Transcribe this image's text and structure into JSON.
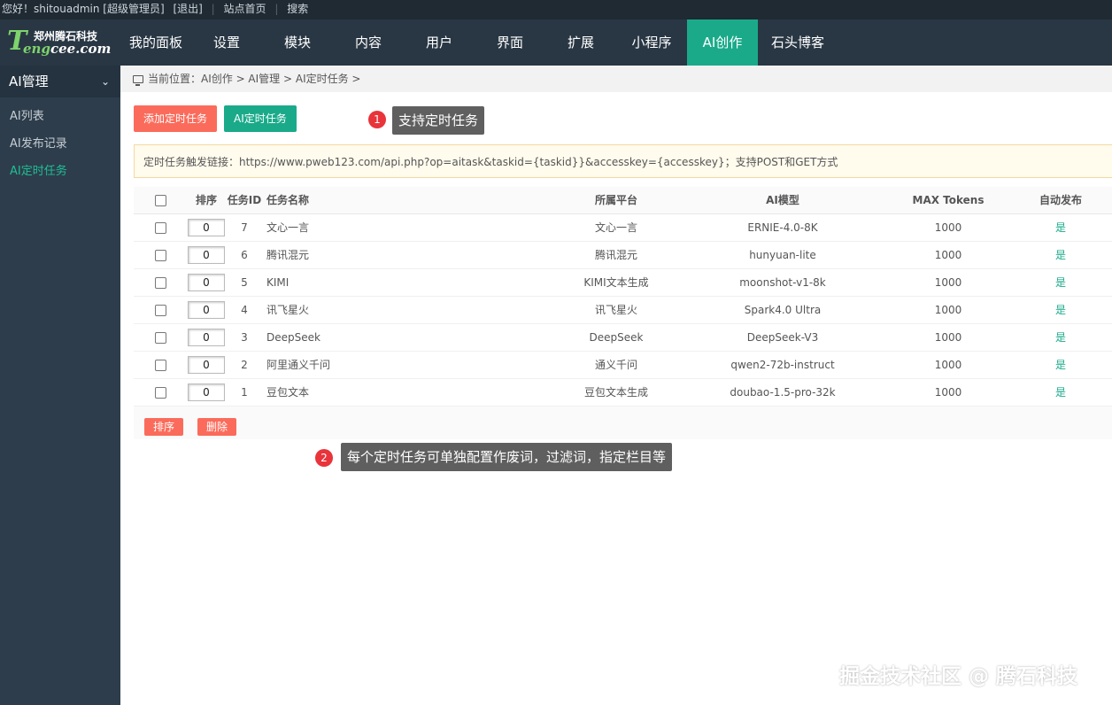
{
  "topbar": {
    "greeting": "您好！shitouadmin [超级管理员]",
    "logout": "[退出]",
    "site_home": "站点首页",
    "search": "搜索"
  },
  "logo": {
    "cn_name": "郑州腾石科技",
    "letter": "T",
    "en_hl": "eng",
    "en_rest": "cee.com"
  },
  "nav": [
    {
      "label": "我的面板",
      "active": false
    },
    {
      "label": "设置",
      "active": false
    },
    {
      "label": "模块",
      "active": false
    },
    {
      "label": "内容",
      "active": false
    },
    {
      "label": "用户",
      "active": false
    },
    {
      "label": "界面",
      "active": false
    },
    {
      "label": "扩展",
      "active": false
    },
    {
      "label": "小程序",
      "active": false
    },
    {
      "label": "AI创作",
      "active": true
    },
    {
      "label": "石头博客",
      "active": false
    }
  ],
  "sidebar": {
    "title": "AI管理",
    "items": [
      {
        "label": "AI列表",
        "active": false
      },
      {
        "label": "AI发布记录",
        "active": false
      },
      {
        "label": "AI定时任务",
        "active": true
      }
    ]
  },
  "breadcrumb": "当前位置：AI创作 > AI管理 > AI定时任务 >",
  "buttons": {
    "add_task": "添加定时任务",
    "ai_task": "AI定时任务",
    "sort": "排序",
    "delete": "删除"
  },
  "callouts": [
    {
      "num": "1",
      "text": "支持定时任务"
    },
    {
      "num": "2",
      "text": "每个定时任务可单独配置作废词，过滤词，指定栏目等"
    }
  ],
  "notice": "定时任务触发链接：https://www.pweb123.com/api.php?op=aitask&taskid={taskid}}&accesskey={accesskey}；支持POST和GET方式",
  "table": {
    "headers": {
      "sort": "排序",
      "task_id": "任务ID",
      "task_name": "任务名称",
      "platform": "所属平台",
      "model": "AI模型",
      "max_tokens": "MAX Tokens",
      "auto_publish": "自动发布"
    },
    "rows": [
      {
        "order": "0",
        "id": "7",
        "name": "文心一言",
        "platform": "文心一言",
        "model": "ERNIE-4.0-8K",
        "tokens": "1000",
        "auto": "是"
      },
      {
        "order": "0",
        "id": "6",
        "name": "腾讯混元",
        "platform": "腾讯混元",
        "model": "hunyuan-lite",
        "tokens": "1000",
        "auto": "是"
      },
      {
        "order": "0",
        "id": "5",
        "name": "KIMI",
        "platform": "KIMI文本生成",
        "model": "moonshot-v1-8k",
        "tokens": "1000",
        "auto": "是"
      },
      {
        "order": "0",
        "id": "4",
        "name": "讯飞星火",
        "platform": "讯飞星火",
        "model": "Spark4.0 Ultra",
        "tokens": "1000",
        "auto": "是"
      },
      {
        "order": "0",
        "id": "3",
        "name": "DeepSeek",
        "platform": "DeepSeek",
        "model": "DeepSeek-V3",
        "tokens": "1000",
        "auto": "是"
      },
      {
        "order": "0",
        "id": "2",
        "name": "阿里通义千问",
        "platform": "通义千问",
        "model": "qwen2-72b-instruct",
        "tokens": "1000",
        "auto": "是"
      },
      {
        "order": "0",
        "id": "1",
        "name": "豆包文本",
        "platform": "豆包文本生成",
        "model": "doubao-1.5-pro-32k",
        "tokens": "1000",
        "auto": "是"
      }
    ]
  },
  "watermark": "掘金技术社区 @ 腾石科技",
  "colors": {
    "accent": "#1aaa8a",
    "danger": "#fb6b5b",
    "header_bg": "#293744",
    "sidebar_bg": "#2e3d4b"
  }
}
